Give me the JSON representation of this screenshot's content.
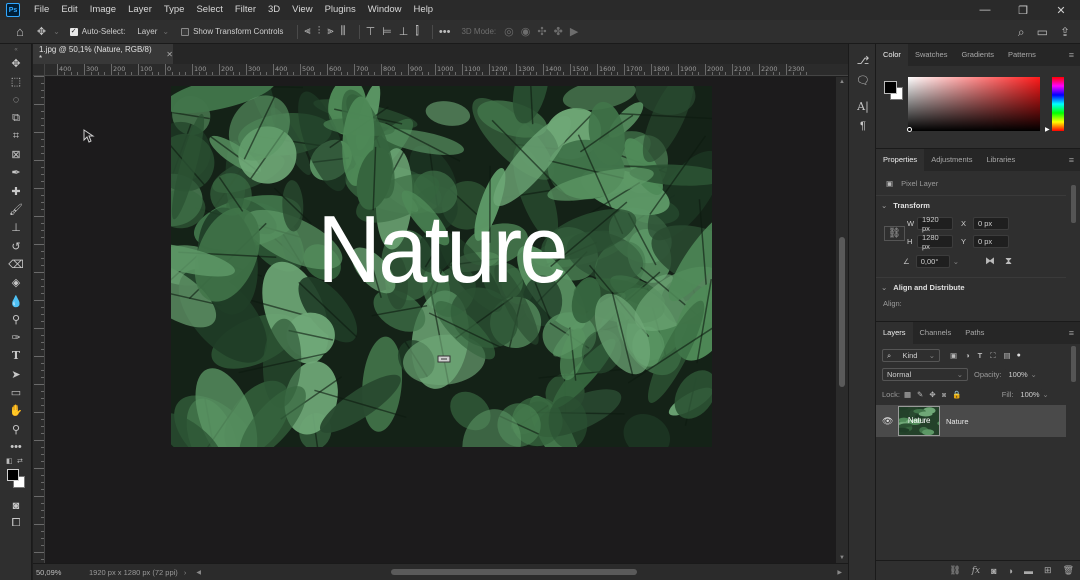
{
  "menubar": {
    "logo": "Ps",
    "items": [
      "File",
      "Edit",
      "Image",
      "Layer",
      "Type",
      "Select",
      "Filter",
      "3D",
      "View",
      "Plugins",
      "Window",
      "Help"
    ]
  },
  "options": {
    "auto_select_label": "Auto-Select:",
    "auto_select_target": "Layer",
    "show_transform_label": "Show Transform Controls",
    "mode_3d_label": "3D Mode:"
  },
  "document": {
    "tab_title": "1.jpg @ 50,1% (Nature, RGB/8) *",
    "image_text": "Nature"
  },
  "rulers": {
    "h_labels": [
      "400",
      "300",
      "200",
      "100",
      "0",
      "100",
      "200",
      "300",
      "400",
      "500",
      "600",
      "700",
      "800",
      "900",
      "1000",
      "1100",
      "1200",
      "1300",
      "1400",
      "1500",
      "1600",
      "1700",
      "1800",
      "1900",
      "2000",
      "2100",
      "2200",
      "2300"
    ]
  },
  "status": {
    "zoom": "50,09%",
    "doc_info": "1920 px x 1280 px (72 ppi)"
  },
  "color_panel": {
    "tabs": [
      "Color",
      "Swatches",
      "Gradients",
      "Patterns"
    ],
    "foreground": "#000000",
    "background": "#ffffff"
  },
  "properties_panel": {
    "tabs": [
      "Properties",
      "Adjustments",
      "Libraries"
    ],
    "layer_kind": "Pixel Layer",
    "transform_title": "Transform",
    "w_label": "W",
    "w_value": "1920 px",
    "h_label": "H",
    "h_value": "1280 px",
    "x_label": "X",
    "x_value": "0 px",
    "y_label": "Y",
    "y_value": "0 px",
    "angle_value": "0,00°",
    "align_title": "Align and Distribute",
    "align_label": "Align:"
  },
  "layers_panel": {
    "tabs": [
      "Layers",
      "Channels",
      "Paths"
    ],
    "filter_kind": "Kind",
    "blend_mode": "Normal",
    "opacity_label": "Opacity:",
    "opacity_value": "100%",
    "lock_label": "Lock:",
    "fill_label": "Fill:",
    "fill_value": "100%",
    "layer_name": "Nature",
    "thumb_text": "Nature"
  },
  "colors": {
    "accent": "#31a8ff",
    "canvas_bg": "#1c1b1c",
    "panel_bg": "#2f2f2f"
  }
}
